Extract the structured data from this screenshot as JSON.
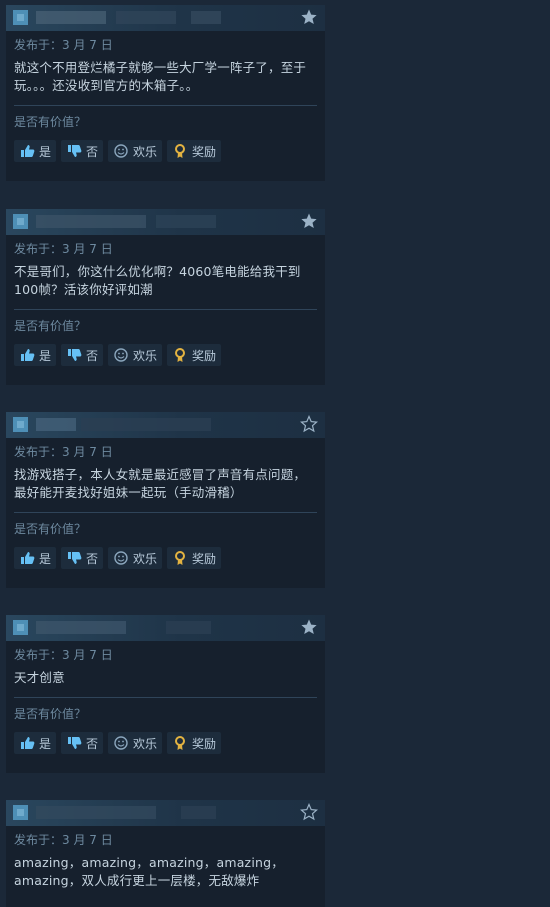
{
  "reviews": [
    {
      "posted": "发布于：3 月 7 日",
      "content": "就这个不用登烂橘子就够一些大厂学一阵子了，至于玩。。。还没收到官方的木箱子。。",
      "helpful_question": "是否有价值？",
      "buttons": {
        "yes": "是",
        "no": "否",
        "funny": "欢乐",
        "award": "奖励"
      },
      "star": "filled"
    },
    {
      "posted": "发布于：3 月 7 日",
      "content": "不是哥们，你这什么优化啊？4060笔电能给我干到100帧？活该你好评如潮",
      "helpful_question": "是否有价值？",
      "buttons": {
        "yes": "是",
        "no": "否",
        "funny": "欢乐",
        "award": "奖励"
      },
      "star": "filled"
    },
    {
      "posted": "发布于：3 月 7 日",
      "content": "找游戏搭子，本人女就是最近感冒了声音有点问题，最好能开麦找好姐妹一起玩（手动滑稽）",
      "helpful_question": "是否有价值？",
      "buttons": {
        "yes": "是",
        "no": "否",
        "funny": "欢乐",
        "award": "奖励"
      },
      "star": "outline"
    },
    {
      "posted": "发布于：3 月 7 日",
      "content": "天才创意",
      "helpful_question": "是否有价值？",
      "buttons": {
        "yes": "是",
        "no": "否",
        "funny": "欢乐",
        "award": "奖励"
      },
      "star": "filled"
    },
    {
      "posted": "发布于：3 月 7 日",
      "content": "amazing，amazing，amazing，amazing，amazing，双人成行更上一层楼，无敌爆炸",
      "star": "outline"
    }
  ],
  "colors": {
    "award": "#e3b341",
    "accent": "#66c0f4"
  }
}
